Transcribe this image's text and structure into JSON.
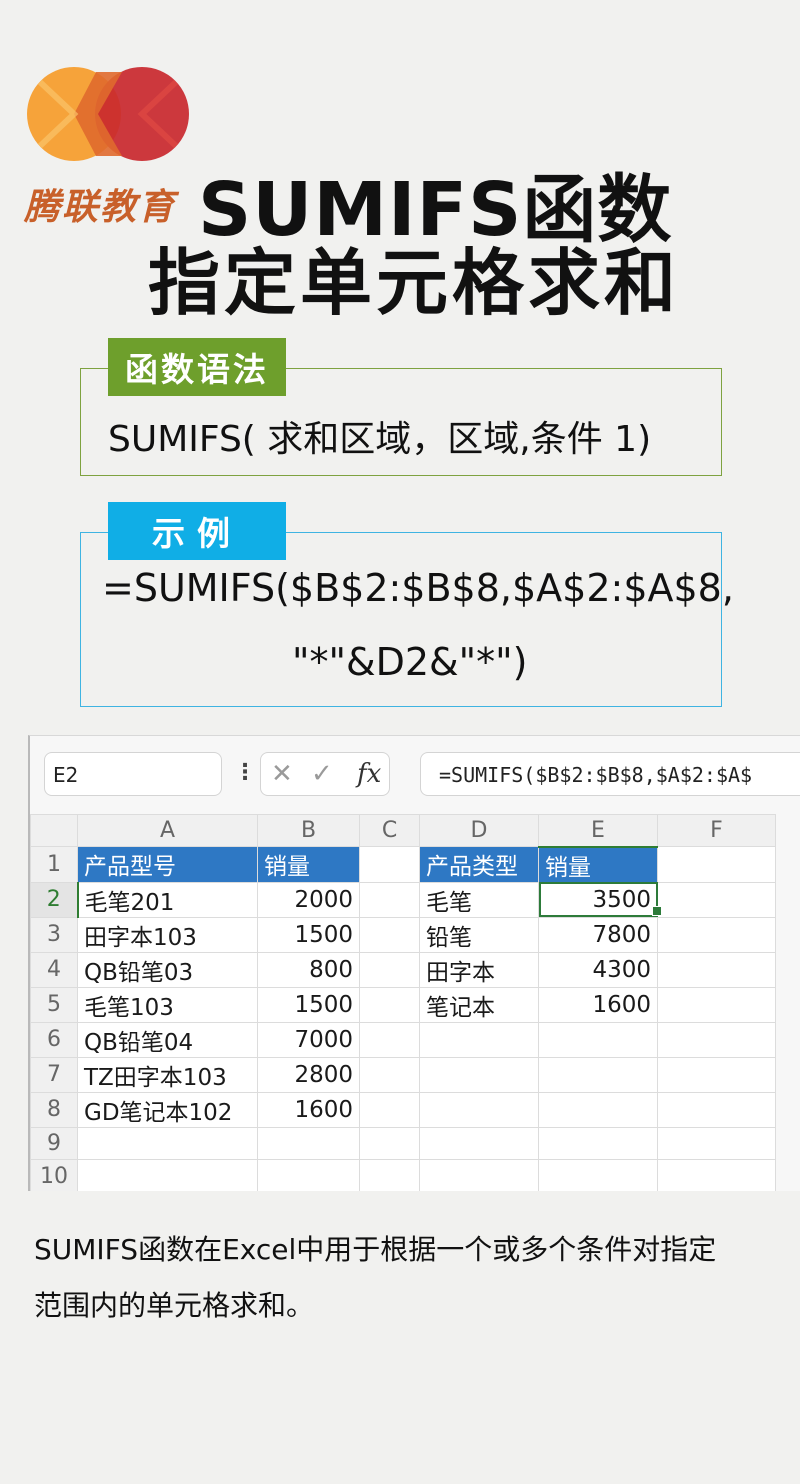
{
  "logo": {
    "brand_name": "腾联教育",
    "color_left": "#f6a33a",
    "color_right": "#c9282e"
  },
  "title": {
    "line1": "SUMIFS函数",
    "line2": "指定单元格求和"
  },
  "syntax": {
    "tag": "函数语法",
    "text": "SUMIFS( 求和区域，区域,条件 1)",
    "accent": "#6e9f2c"
  },
  "example": {
    "tag": "示例",
    "line1": "=SUMIFS($B$2:$B$8,$A$2:$A$8,",
    "line2": "\"*\"&D2&\"*\")",
    "accent": "#10aee6"
  },
  "spreadsheet": {
    "name_box": "E2",
    "menu_icon": "vertical-dots-icon",
    "cancel_icon": "✕",
    "confirm_icon": "✓",
    "fx_label": "fx",
    "formula": "=SUMIFS($B$2:$B$8,$A$2:$A$",
    "columns": [
      "A",
      "B",
      "C",
      "D",
      "E",
      "F"
    ],
    "rows": [
      {
        "num": "1",
        "A": "产品型号",
        "B": "销量",
        "C": "",
        "D": "产品类型",
        "E": "销量",
        "F": ""
      },
      {
        "num": "2",
        "A": "毛笔201",
        "B": "2000",
        "C": "",
        "D": "毛笔",
        "E": "3500",
        "F": ""
      },
      {
        "num": "3",
        "A": "田字本103",
        "B": "1500",
        "C": "",
        "D": "铅笔",
        "E": "7800",
        "F": ""
      },
      {
        "num": "4",
        "A": "QB铅笔03",
        "B": "800",
        "C": "",
        "D": "田字本",
        "E": "4300",
        "F": ""
      },
      {
        "num": "5",
        "A": "毛笔103",
        "B": "1500",
        "C": "",
        "D": "笔记本",
        "E": "1600",
        "F": ""
      },
      {
        "num": "6",
        "A": "QB铅笔04",
        "B": "7000",
        "C": "",
        "D": "",
        "E": "",
        "F": ""
      },
      {
        "num": "7",
        "A": "TZ田字本103",
        "B": "2800",
        "C": "",
        "D": "",
        "E": "",
        "F": ""
      },
      {
        "num": "8",
        "A": "GD笔记本102",
        "B": "1600",
        "C": "",
        "D": "",
        "E": "",
        "F": ""
      },
      {
        "num": "9",
        "A": "",
        "B": "",
        "C": "",
        "D": "",
        "E": "",
        "F": ""
      },
      {
        "num": "10",
        "A": "",
        "B": "",
        "C": "",
        "D": "",
        "E": "",
        "F": ""
      }
    ],
    "header_fill": "#2e78c4",
    "selection_color": "#2d7b3a"
  },
  "description": "SUMIFS函数在Excel中用于根据一个或多个条件对指定范围内的单元格求和。"
}
